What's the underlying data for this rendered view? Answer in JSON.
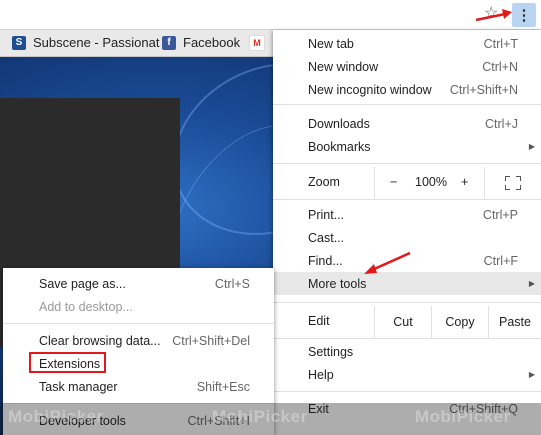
{
  "toolbar": {
    "star_icon": "star-outline-icon",
    "menu_icon": "vertical-dots-icon"
  },
  "bookmarks": [
    {
      "label": "Subscene - Passionat",
      "icon": "S"
    },
    {
      "label": "Facebook",
      "icon": "f"
    },
    {
      "label": "",
      "icon": "M"
    }
  ],
  "menu": {
    "new_tab": {
      "label": "New tab",
      "shortcut": "Ctrl+T"
    },
    "new_window": {
      "label": "New window",
      "shortcut": "Ctrl+N"
    },
    "new_incognito": {
      "label": "New incognito window",
      "shortcut": "Ctrl+Shift+N"
    },
    "downloads": {
      "label": "Downloads",
      "shortcut": "Ctrl+J"
    },
    "bookmarks": {
      "label": "Bookmarks"
    },
    "zoom": {
      "label": "Zoom",
      "minus": "−",
      "value": "100%",
      "plus": "+"
    },
    "print": {
      "label": "Print...",
      "shortcut": "Ctrl+P"
    },
    "cast": {
      "label": "Cast..."
    },
    "find": {
      "label": "Find...",
      "shortcut": "Ctrl+F"
    },
    "more_tools": {
      "label": "More tools"
    },
    "edit": {
      "label": "Edit",
      "cut": "Cut",
      "copy": "Copy",
      "paste": "Paste"
    },
    "settings": {
      "label": "Settings"
    },
    "help": {
      "label": "Help"
    },
    "exit": {
      "label": "Exit",
      "shortcut": "Ctrl+Shift+Q"
    }
  },
  "submenu": {
    "save_page": {
      "label": "Save page as...",
      "shortcut": "Ctrl+S"
    },
    "add_desktop": {
      "label": "Add to desktop..."
    },
    "clear_data": {
      "label": "Clear browsing data...",
      "shortcut": "Ctrl+Shift+Del"
    },
    "extensions": {
      "label": "Extensions"
    },
    "task_manager": {
      "label": "Task manager",
      "shortcut": "Shift+Esc"
    },
    "dev_tools": {
      "label": "Developer tools",
      "shortcut": "Ctrl+Shift+I"
    }
  },
  "watermark": {
    "text": "MobiPicker"
  },
  "colors": {
    "highlight": "#e0191b",
    "menu_button_bg": "#b9d4f0",
    "hover_row": "#e8e8e8"
  }
}
